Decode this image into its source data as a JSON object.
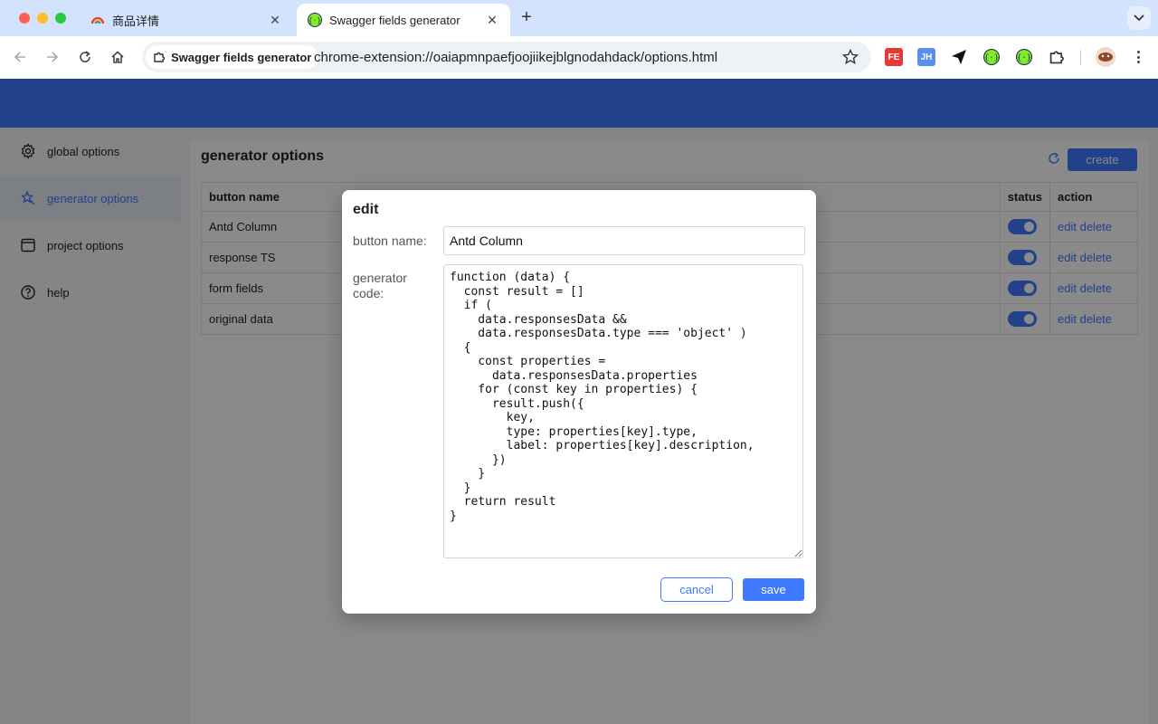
{
  "browser": {
    "tabs": [
      {
        "title": "商品详情",
        "favicon": "rainbow-icon"
      },
      {
        "title": "Swagger fields generator",
        "favicon": "swagger-icon",
        "active": true
      }
    ],
    "new_tab": "+",
    "origin_chip": "Swagger fields generator",
    "url": "chrome-extension://oaiapmnpaefjoojiikejblgnodahdack/options.html",
    "extensions": [
      "FE",
      "JH"
    ]
  },
  "sidebar": {
    "items": [
      {
        "label": "global options",
        "icon": "gear-icon"
      },
      {
        "label": "generator options",
        "icon": "magic-icon",
        "active": true
      },
      {
        "label": "project options",
        "icon": "window-icon"
      },
      {
        "label": "help",
        "icon": "help-icon"
      }
    ]
  },
  "main": {
    "title": "generator options",
    "create_label": "create",
    "table": {
      "headers": {
        "name": "button name",
        "status": "status",
        "action": "action"
      },
      "rows": [
        {
          "name": "Antd Column",
          "enabled": true
        },
        {
          "name": "response TS",
          "enabled": true
        },
        {
          "name": "form fields",
          "enabled": true
        },
        {
          "name": "original data",
          "enabled": true
        }
      ],
      "edit_label": "edit",
      "delete_label": "delete"
    }
  },
  "modal": {
    "title": "edit",
    "name_label": "button name:",
    "name_value": "Antd Column",
    "code_label": "generator code:",
    "code": "function (data) {\n  const result = []\n  if (\n    data.responsesData &&\n    data.responsesData.type === 'object' )\n  {\n    const properties =\n      data.responsesData.properties\n    for (const key in properties) {\n      result.push({\n        key,\n        type: properties[key].type,\n        label: properties[key].description,\n      })\n    }\n  }\n  return result\n}",
    "cancel_label": "cancel",
    "save_label": "save"
  },
  "colors": {
    "accent": "#3f79ff",
    "chrome_bg": "#d3e3fd"
  }
}
